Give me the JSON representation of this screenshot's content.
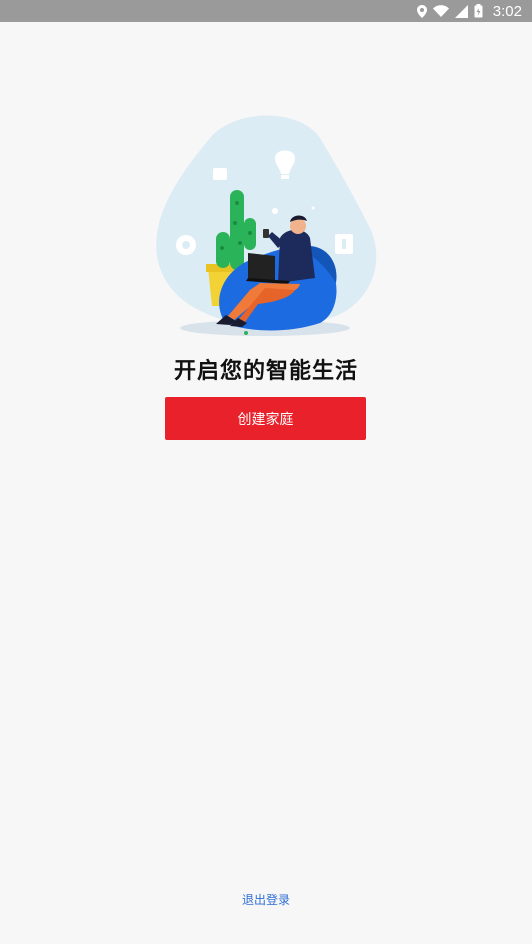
{
  "status_bar": {
    "time": "3:02",
    "icons": [
      "location-icon",
      "wifi-icon",
      "signal-icon",
      "battery-icon"
    ]
  },
  "main": {
    "headline": "开启您的智能生活",
    "create_button_label": "创建家庭",
    "illustration": "person-on-beanbag-with-laptop-smart-home-illustration"
  },
  "footer": {
    "logout_label": "退出登录"
  },
  "colors": {
    "accent": "#e8212b",
    "link": "#2f6fd6",
    "background": "#f7f7f7",
    "status_bar": "#9a9a9a"
  }
}
